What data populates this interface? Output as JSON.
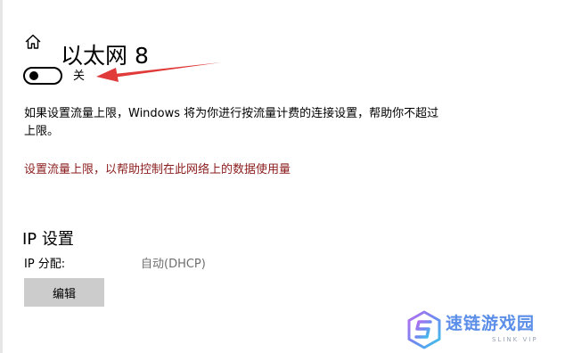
{
  "header": {
    "home_icon": "home-icon",
    "title": "以太网 8"
  },
  "metered_connection": {
    "toggle_state": "off",
    "toggle_label": "关"
  },
  "annotation": {
    "arrow_color": "#e03a3a"
  },
  "description": "如果设置流量上限，Windows 将为你进行按流量计费的连接设置，帮助你不超过上限。",
  "data_limit_link": {
    "text": "设置流量上限，以帮助控制在此网络上的数据使用量",
    "color": "#8b1c1c"
  },
  "ip_settings": {
    "heading": "IP 设置",
    "assignment_label": "IP 分配:",
    "assignment_value": "自动(DHCP)",
    "edit_button": "编辑"
  },
  "watermark": {
    "name": "速链游戏园",
    "subtitle": "SLINK VIP",
    "color": "#5b8ee8"
  }
}
